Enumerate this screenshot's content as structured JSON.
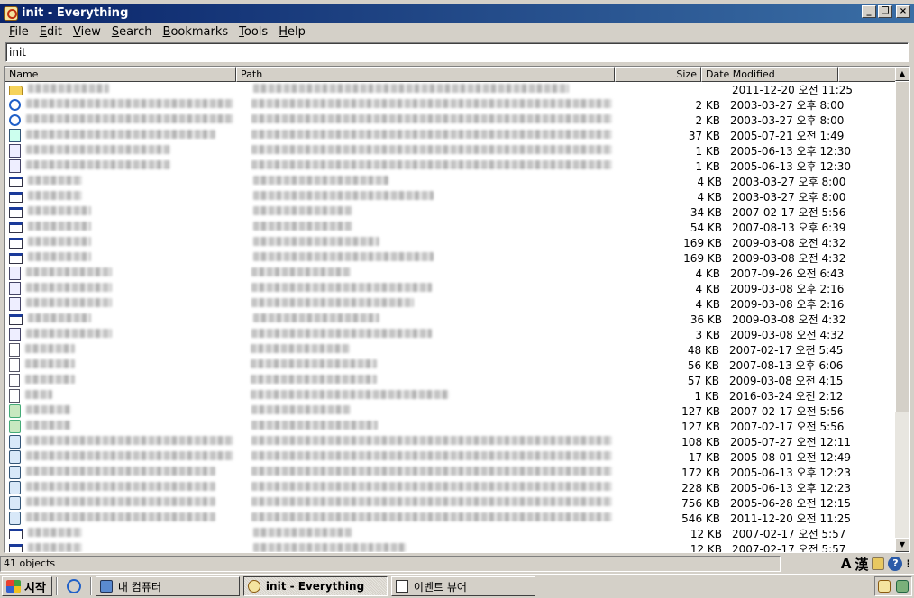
{
  "window": {
    "title": "init - Everything",
    "controls": [
      "_",
      "❐",
      "×"
    ]
  },
  "menu": [
    {
      "label": "File",
      "mnemonic": "F",
      "rest": "ile"
    },
    {
      "label": "Edit",
      "mnemonic": "E",
      "rest": "dit"
    },
    {
      "label": "View",
      "mnemonic": "V",
      "rest": "iew"
    },
    {
      "label": "Search",
      "mnemonic": "S",
      "rest": "earch"
    },
    {
      "label": "Bookmarks",
      "mnemonic": "B",
      "rest": "ookmarks"
    },
    {
      "label": "Tools",
      "mnemonic": "T",
      "rest": "ools"
    },
    {
      "label": "Help",
      "mnemonic": "H",
      "rest": "elp"
    }
  ],
  "search": {
    "value": "init"
  },
  "columns": {
    "name": "Name",
    "path": "Path",
    "size": "Size",
    "date": "Date Modified"
  },
  "rows": [
    {
      "icon": "folder-icon",
      "size": "",
      "date": "2011-12-20 오전 11:25"
    },
    {
      "icon": "ie-icon",
      "size": "2 KB",
      "date": "2003-03-27 오후 8:00"
    },
    {
      "icon": "ie-icon",
      "size": "2 KB",
      "date": "2003-03-27 오후 8:00"
    },
    {
      "icon": "network-file-icon",
      "size": "37 KB",
      "date": "2005-07-21 오전 1:49"
    },
    {
      "icon": "config-file-icon",
      "size": "1 KB",
      "date": "2005-06-13 오후 12:30"
    },
    {
      "icon": "config-file-icon",
      "size": "1 KB",
      "date": "2005-06-13 오후 12:30"
    },
    {
      "icon": "window-file-icon",
      "size": "4 KB",
      "date": "2003-03-27 오후 8:00"
    },
    {
      "icon": "window-file-icon",
      "size": "4 KB",
      "date": "2003-03-27 오후 8:00"
    },
    {
      "icon": "window-file-icon",
      "size": "34 KB",
      "date": "2007-02-17 오전 5:56"
    },
    {
      "icon": "window-file-icon",
      "size": "54 KB",
      "date": "2007-08-13 오후 6:39"
    },
    {
      "icon": "window-file-icon",
      "size": "169 KB",
      "date": "2009-03-08 오전 4:32"
    },
    {
      "icon": "window-file-icon",
      "size": "169 KB",
      "date": "2009-03-08 오전 4:32"
    },
    {
      "icon": "calc-file-icon",
      "size": "4 KB",
      "date": "2007-09-26 오전 6:43"
    },
    {
      "icon": "calc-file-icon",
      "size": "4 KB",
      "date": "2009-03-08 오후 2:16"
    },
    {
      "icon": "calc-file-icon",
      "size": "4 KB",
      "date": "2009-03-08 오후 2:16"
    },
    {
      "icon": "window-file-icon",
      "size": "36 KB",
      "date": "2009-03-08 오전 4:32"
    },
    {
      "icon": "calc-file-icon",
      "size": "3 KB",
      "date": "2009-03-08 오전 4:32"
    },
    {
      "icon": "script-file-icon",
      "size": "48 KB",
      "date": "2007-02-17 오전 5:45"
    },
    {
      "icon": "script-file-icon",
      "size": "56 KB",
      "date": "2007-08-13 오후 6:06"
    },
    {
      "icon": "script-file-icon",
      "size": "57 KB",
      "date": "2009-03-08 오전 4:15"
    },
    {
      "icon": "text-file-icon",
      "size": "1 KB",
      "date": "2016-03-24 오전 2:12"
    },
    {
      "icon": "green-file-icon",
      "size": "127 KB",
      "date": "2007-02-17 오전 5:56"
    },
    {
      "icon": "green-file-icon",
      "size": "127 KB",
      "date": "2007-02-17 오전 5:56"
    },
    {
      "icon": "gear-file-icon",
      "size": "108 KB",
      "date": "2005-07-27 오전 12:11"
    },
    {
      "icon": "gear-file-icon",
      "size": "17 KB",
      "date": "2005-08-01 오전 12:49"
    },
    {
      "icon": "gear-file-icon",
      "size": "172 KB",
      "date": "2005-06-13 오후 12:23"
    },
    {
      "icon": "gear-file-icon",
      "size": "228 KB",
      "date": "2005-06-13 오후 12:23"
    },
    {
      "icon": "gear-file-icon",
      "size": "756 KB",
      "date": "2005-06-28 오전 12:15"
    },
    {
      "icon": "gear-file-icon",
      "size": "546 KB",
      "date": "2011-12-20 오전 11:25"
    },
    {
      "icon": "window-file-icon",
      "size": "12 KB",
      "date": "2007-02-17 오전 5:57"
    },
    {
      "icon": "window-file-icon",
      "size": "12 KB",
      "date": "2007-02-17 오전 5:57"
    }
  ],
  "status": {
    "count": "41 objects"
  },
  "ime": {
    "mode_a": "A",
    "mode_han": "漢",
    "help": "?"
  },
  "taskbar": {
    "start_label": "시작",
    "tasks": [
      {
        "label": "내 컴퓨터",
        "active": false
      },
      {
        "label": "init - Everything",
        "active": true
      },
      {
        "label": "이벤트 뷰어",
        "active": false
      }
    ]
  }
}
